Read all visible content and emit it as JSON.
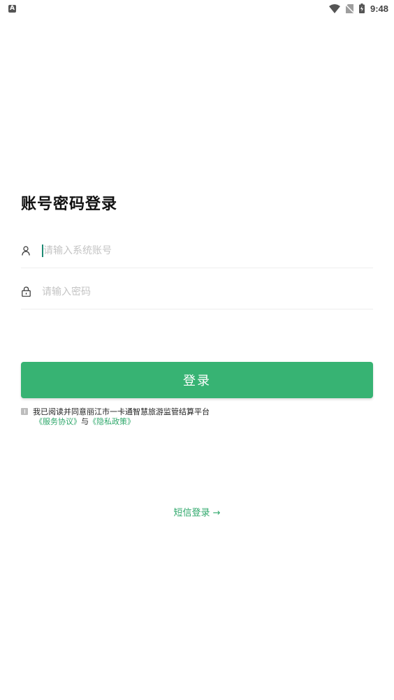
{
  "status_bar": {
    "app_icon": "A",
    "time": "9:48",
    "icons": [
      "wifi-icon",
      "no-sim-icon",
      "battery-charging-icon"
    ]
  },
  "login": {
    "title": "账号密码登录",
    "account_placeholder": "请输入系统账号",
    "password_placeholder": "请输入密码",
    "account_icon": "user-icon",
    "password_icon": "lock-icon",
    "submit_label": "登录"
  },
  "agreement": {
    "text": "我已阅读并同意丽江市一卡通智慧旅游监管结算平台",
    "service_link": "《服务协议》",
    "conjunction": "与",
    "privacy_link": "《隐私政策》",
    "checked": false
  },
  "sms_login": {
    "label": "短信登录",
    "arrow": "→"
  },
  "colors": {
    "primary": "#37b373",
    "link": "#2fa86b",
    "placeholder": "#c4c4c4",
    "divider": "#eeeeee"
  }
}
